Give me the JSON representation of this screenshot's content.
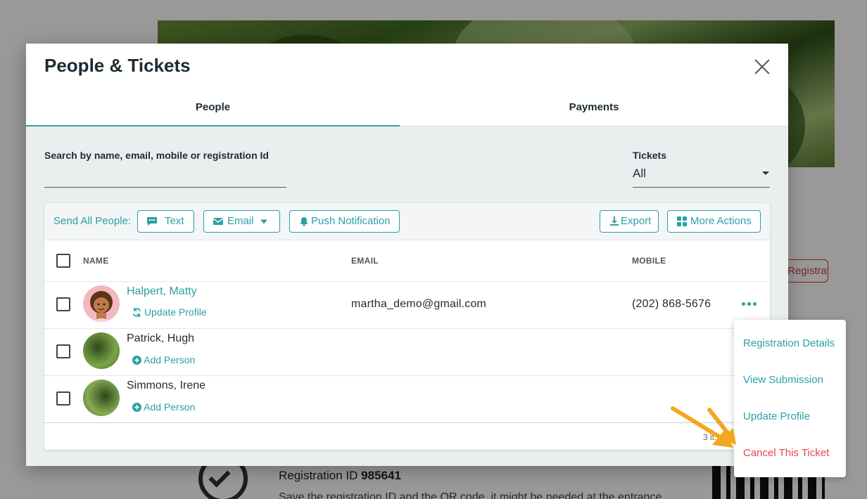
{
  "background": {
    "registration_button": "Registration",
    "registration_id_label": "Registration ID",
    "registration_id_value": "985641",
    "save_note": "Save the registration ID and the QR code, it might be needed at the entrance."
  },
  "modal": {
    "title": "People & Tickets",
    "tabs": [
      {
        "label": "People",
        "active": true
      },
      {
        "label": "Payments",
        "active": false
      }
    ],
    "search": {
      "label": "Search by name, email, mobile or registration Id",
      "value": "",
      "placeholder": ""
    },
    "tickets_filter": {
      "label": "Tickets",
      "value": "All"
    },
    "toolbar": {
      "send_all_label": "Send All People:",
      "text_button": "Text",
      "email_button": "Email",
      "push_button": "Push Notification",
      "export_button": "Export",
      "more_actions_button": "More Actions"
    },
    "columns": {
      "name": "NAME",
      "email": "EMAIL",
      "mobile": "MOBILE"
    },
    "rows": [
      {
        "name": "Halpert, Matty",
        "action": "Update Profile",
        "email": "martha_demo@gmail.com",
        "mobile": "(202) 868-5676"
      },
      {
        "name": "Patrick, Hugh",
        "action": "Add Person",
        "email": "",
        "mobile": ""
      },
      {
        "name": "Simmons, Irene",
        "action": "Add Person",
        "email": "",
        "mobile": ""
      }
    ],
    "footer": "3 it..."
  },
  "row_menu": {
    "items": [
      {
        "label": "Registration Details"
      },
      {
        "label": "View Submission"
      },
      {
        "label": "Update Profile"
      },
      {
        "label": "Cancel This Ticket"
      }
    ]
  },
  "colors": {
    "accent": "#2ba0a6",
    "danger": "#e24a4a",
    "annotation_arrow": "#f2a81d"
  },
  "icons": {
    "close": "close-icon",
    "text": "chat-icon",
    "email": "envelope-icon",
    "push": "bell-icon",
    "export": "download-icon",
    "more_actions": "grid-icon",
    "update_profile": "refresh-icon",
    "add_person": "plus-circle-icon",
    "row_more": "ellipsis-icon"
  }
}
